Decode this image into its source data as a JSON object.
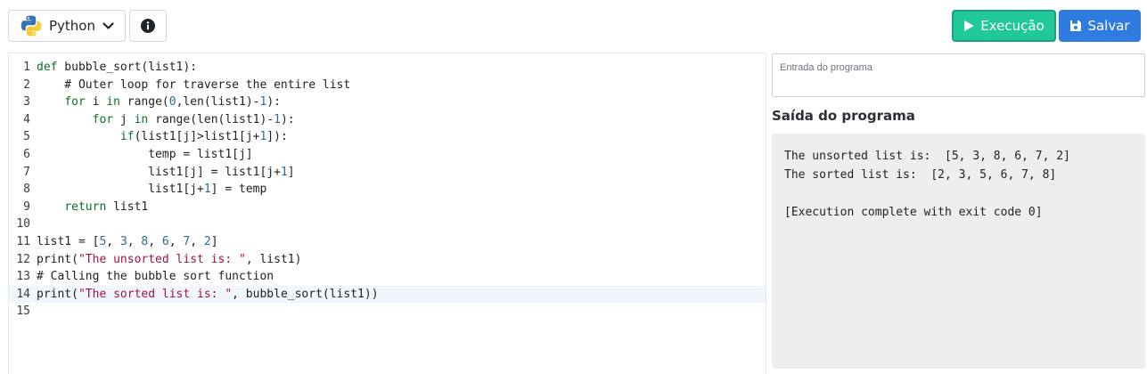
{
  "toolbar": {
    "language_label": "Python",
    "run_label": "Execução",
    "save_label": "Salvar",
    "icons": {
      "language": "python-logo-icon",
      "dropdown": "chevron-down-icon",
      "info": "info-icon",
      "run": "play-icon",
      "save": "floppy-disk-icon"
    },
    "colors": {
      "run": "#20c997",
      "save": "#2f7be0"
    }
  },
  "editor": {
    "active_line": 14,
    "lines": [
      {
        "n": "1",
        "tokens": [
          {
            "t": "def",
            "c": "kw"
          },
          {
            "t": " bubble_sort(list1):"
          }
        ]
      },
      {
        "n": "2",
        "tokens": [
          {
            "t": "    # Outer loop for traverse the entire list"
          }
        ]
      },
      {
        "n": "3",
        "tokens": [
          {
            "t": "    "
          },
          {
            "t": "for",
            "c": "kw"
          },
          {
            "t": " i "
          },
          {
            "t": "in",
            "c": "kw"
          },
          {
            "t": " range("
          },
          {
            "t": "0",
            "c": "num"
          },
          {
            "t": ",len(list1)-"
          },
          {
            "t": "1",
            "c": "num"
          },
          {
            "t": "):"
          }
        ]
      },
      {
        "n": "4",
        "tokens": [
          {
            "t": "        "
          },
          {
            "t": "for",
            "c": "kw"
          },
          {
            "t": " j "
          },
          {
            "t": "in",
            "c": "kw"
          },
          {
            "t": " range(len(list1)-"
          },
          {
            "t": "1",
            "c": "num"
          },
          {
            "t": "):"
          }
        ]
      },
      {
        "n": "5",
        "tokens": [
          {
            "t": "            "
          },
          {
            "t": "if",
            "c": "kw"
          },
          {
            "t": "(list1[j]>list1[j+"
          },
          {
            "t": "1",
            "c": "num"
          },
          {
            "t": "]):"
          }
        ]
      },
      {
        "n": "6",
        "tokens": [
          {
            "t": "                temp = list1[j]"
          }
        ]
      },
      {
        "n": "7",
        "tokens": [
          {
            "t": "                list1[j] = list1[j+"
          },
          {
            "t": "1",
            "c": "num"
          },
          {
            "t": "]"
          }
        ]
      },
      {
        "n": "8",
        "tokens": [
          {
            "t": "                list1[j+"
          },
          {
            "t": "1",
            "c": "num"
          },
          {
            "t": "] = temp"
          }
        ]
      },
      {
        "n": "9",
        "tokens": [
          {
            "t": "    "
          },
          {
            "t": "return",
            "c": "kw"
          },
          {
            "t": " list1"
          }
        ]
      },
      {
        "n": "10",
        "tokens": []
      },
      {
        "n": "11",
        "tokens": [
          {
            "t": "list1 = ["
          },
          {
            "t": "5",
            "c": "num"
          },
          {
            "t": ", "
          },
          {
            "t": "3",
            "c": "num"
          },
          {
            "t": ", "
          },
          {
            "t": "8",
            "c": "num"
          },
          {
            "t": ", "
          },
          {
            "t": "6",
            "c": "num"
          },
          {
            "t": ", "
          },
          {
            "t": "7",
            "c": "num"
          },
          {
            "t": ", "
          },
          {
            "t": "2",
            "c": "num"
          },
          {
            "t": "]"
          }
        ]
      },
      {
        "n": "12",
        "tokens": [
          {
            "t": "print("
          },
          {
            "t": "\"The unsorted list is: \"",
            "c": "str"
          },
          {
            "t": ", list1)"
          }
        ]
      },
      {
        "n": "13",
        "tokens": [
          {
            "t": "# Calling the bubble sort function"
          }
        ]
      },
      {
        "n": "14",
        "tokens": [
          {
            "t": "print("
          },
          {
            "t": "\"The sorted list is: \"",
            "c": "str"
          },
          {
            "t": ", bubble_sort(list1))"
          }
        ]
      },
      {
        "n": "15",
        "tokens": []
      }
    ]
  },
  "program_input": {
    "placeholder": "Entrada do programa",
    "value": ""
  },
  "program_output": {
    "title": "Saída do programa",
    "lines": [
      "The unsorted list is:  [5, 3, 8, 6, 7, 2]",
      "The sorted list is:  [2, 3, 5, 6, 7, 8]",
      "",
      "[Execution complete with exit code 0]"
    ]
  }
}
